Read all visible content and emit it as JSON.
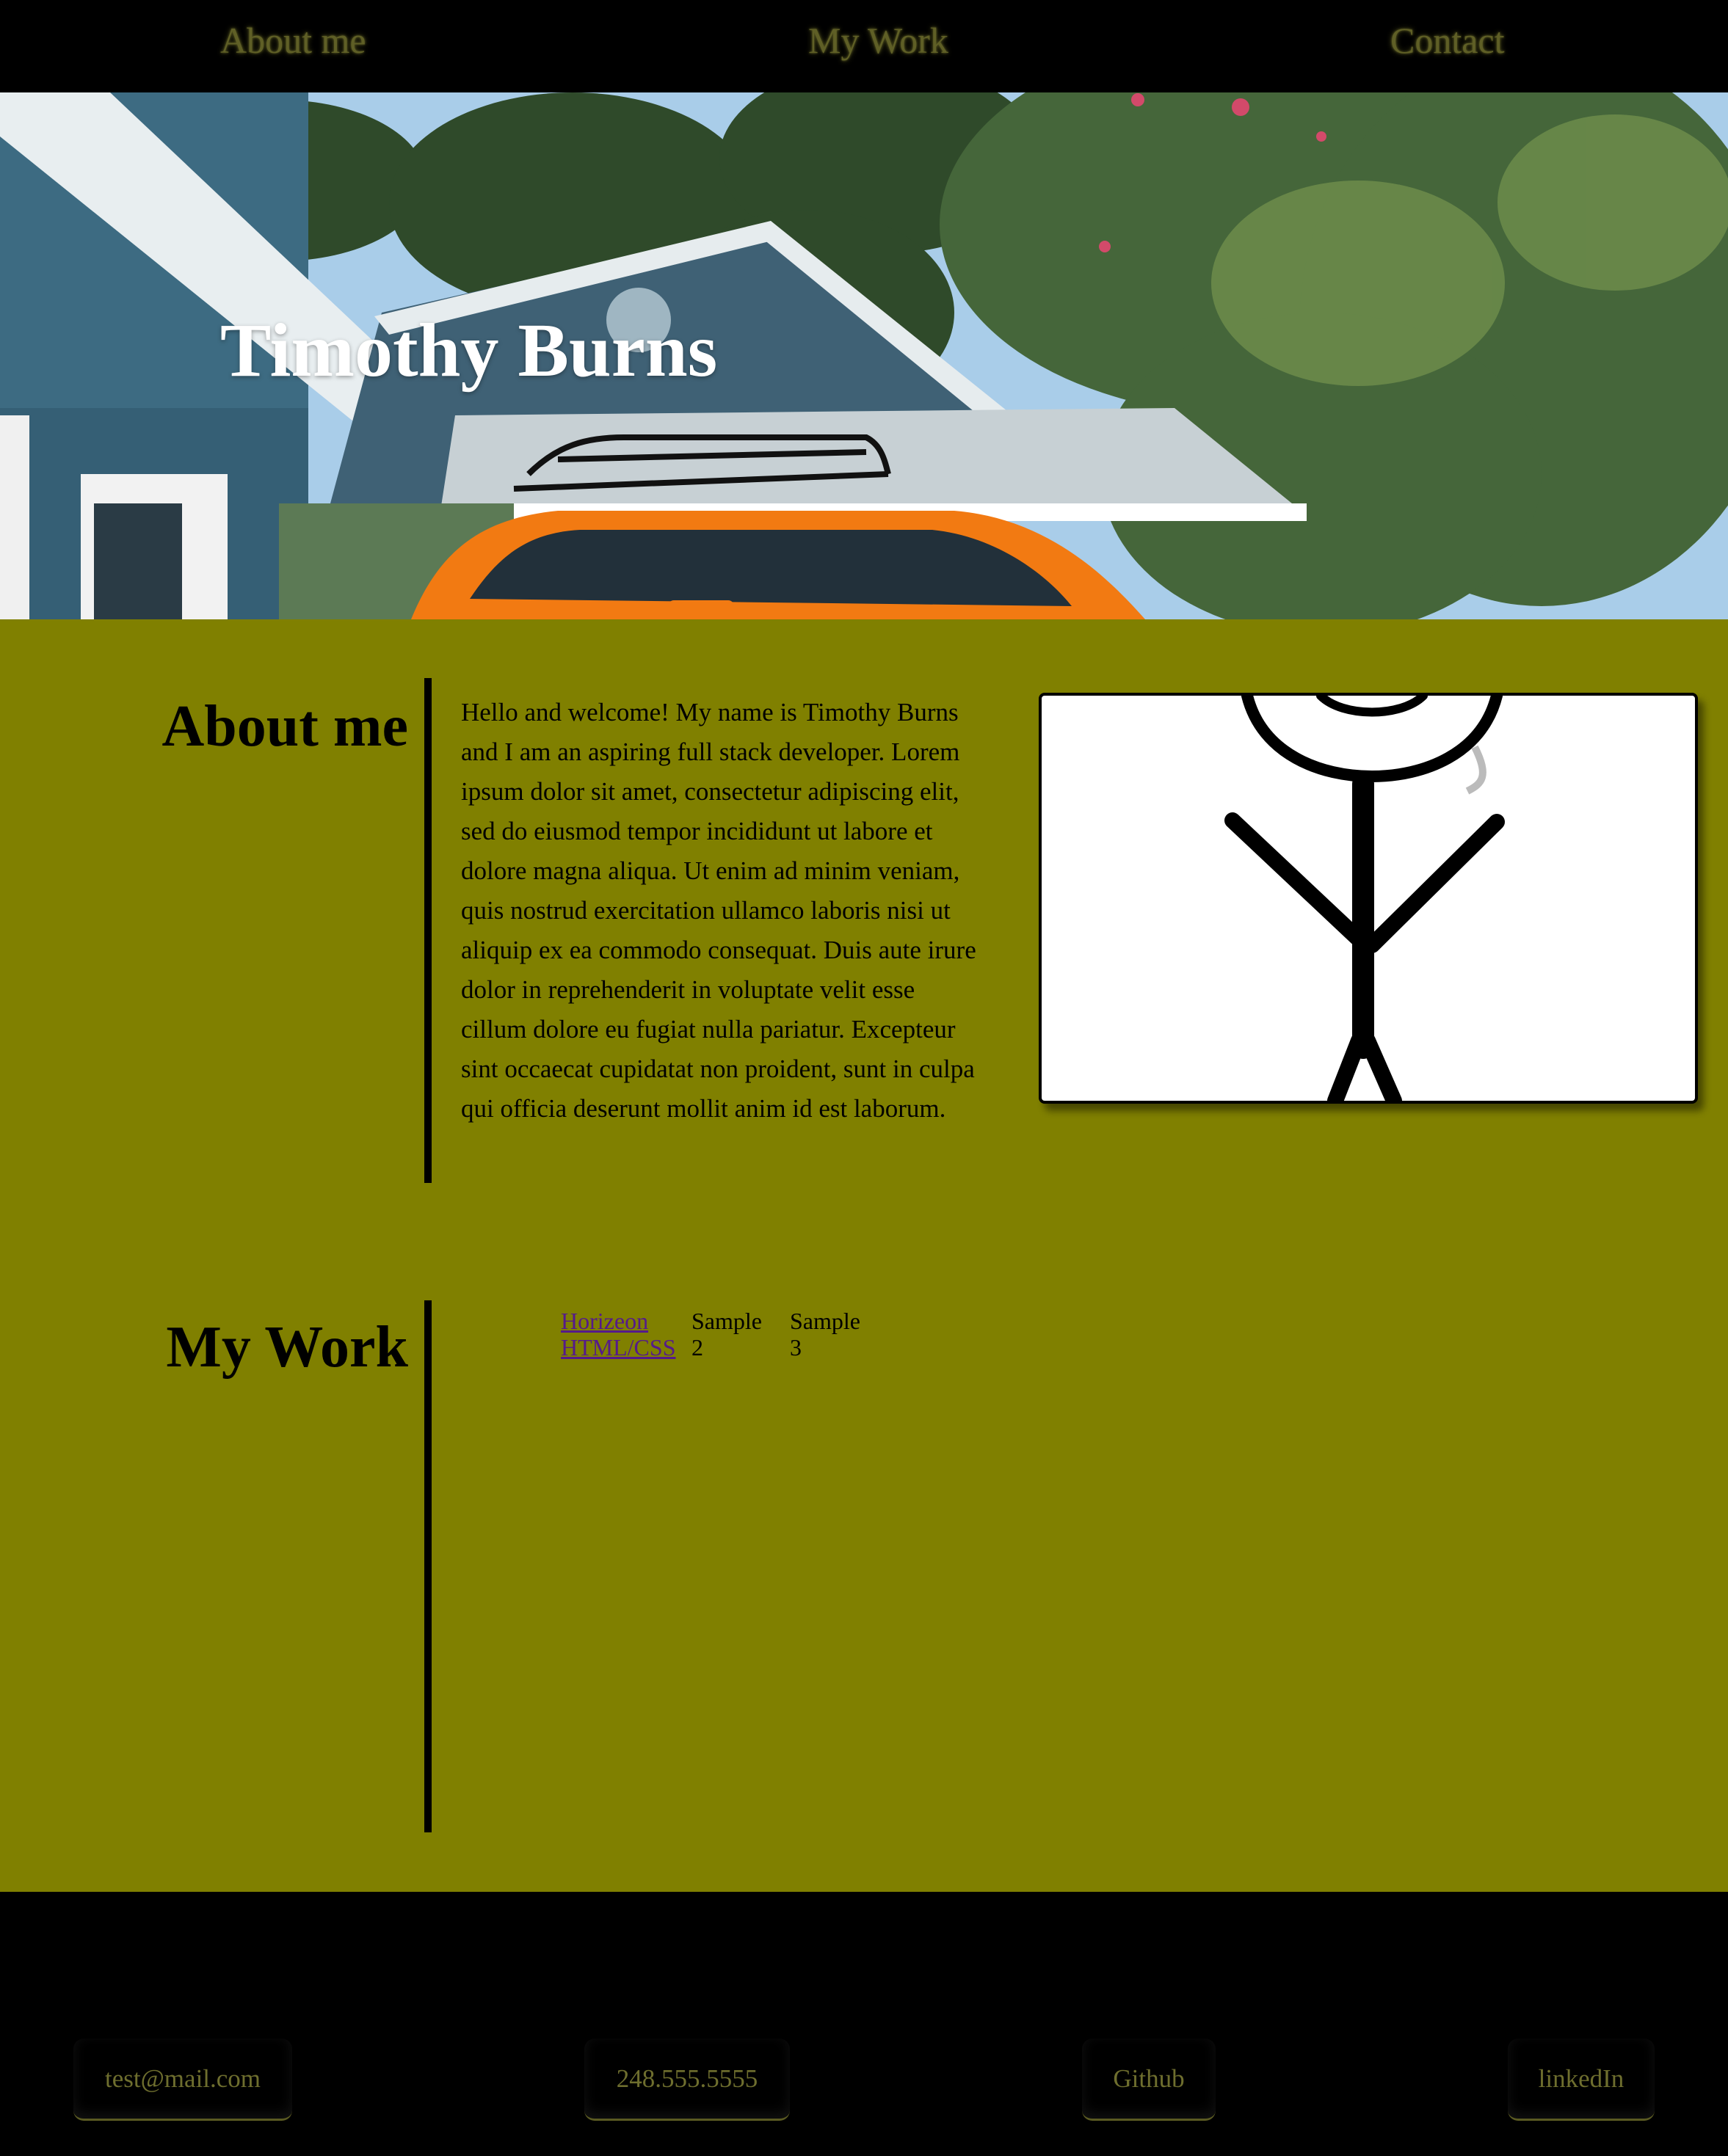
{
  "nav": {
    "items": [
      {
        "label": "About me"
      },
      {
        "label": "My Work"
      },
      {
        "label": "Contact"
      }
    ]
  },
  "hero": {
    "title": "Timothy Burns"
  },
  "about": {
    "heading": "About me",
    "text": "Hello and welcome! My name is Timothy Burns and I am an aspiring full stack developer. Lorem ipsum dolor sit amet, consectetur adipiscing elit, sed do eiusmod tempor incididunt ut labore et dolore magna aliqua. Ut enim ad minim veniam, quis nostrud exercitation ullamco laboris nisi ut aliquip ex ea commodo consequat. Duis aute irure dolor in reprehenderit in voluptate velit esse cillum dolore eu fugiat nulla pariatur. Excepteur sint occaecat cupidatat non proident, sunt in culpa qui officia deserunt mollit anim id est laborum."
  },
  "work": {
    "heading": "My Work",
    "items": [
      {
        "line1": "Horizeon",
        "line2": "HTML/CSS"
      },
      {
        "line1": "Sample",
        "line2": "2"
      },
      {
        "line1": "Sample",
        "line2": "3"
      }
    ]
  },
  "footer": {
    "contacts": [
      {
        "label": "test@mail.com"
      },
      {
        "label": "248.555.5555"
      },
      {
        "label": "Github"
      },
      {
        "label": "linkedIn"
      }
    ]
  },
  "colors": {
    "page_background": "#808000",
    "nav_background": "#000000",
    "footer_background": "#000000",
    "link_visited": "#551a8b"
  }
}
